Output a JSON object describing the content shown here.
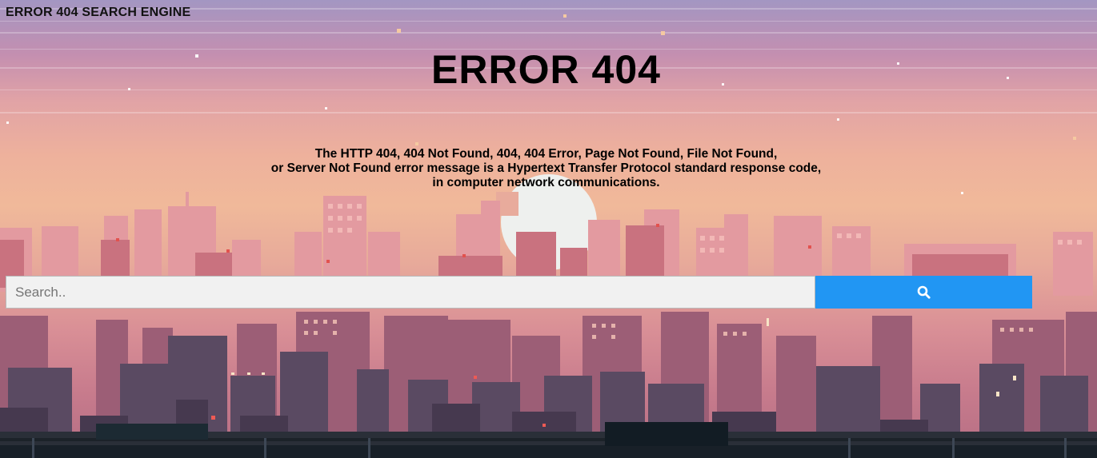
{
  "site_title": "ERROR 404 SEARCH ENGINE",
  "headline": "ERROR 404",
  "description": {
    "line1": "The HTTP 404, 404 Not Found, 404, 404 Error, Page Not Found, File Not Found,",
    "line2": "or Server Not Found error message is a Hypertext Transfer Protocol standard response code,",
    "line3": "in computer network communications."
  },
  "search": {
    "placeholder": "Search..",
    "value": "",
    "button_icon": "search-icon",
    "button_color": "#2196f3"
  },
  "background": {
    "scene": "pixel-art-city-skyline-sunset",
    "moon_icon": "moon-icon"
  },
  "colors": {
    "text": "#000000",
    "input_bg": "#f1f1f1",
    "accent": "#2196f3"
  }
}
